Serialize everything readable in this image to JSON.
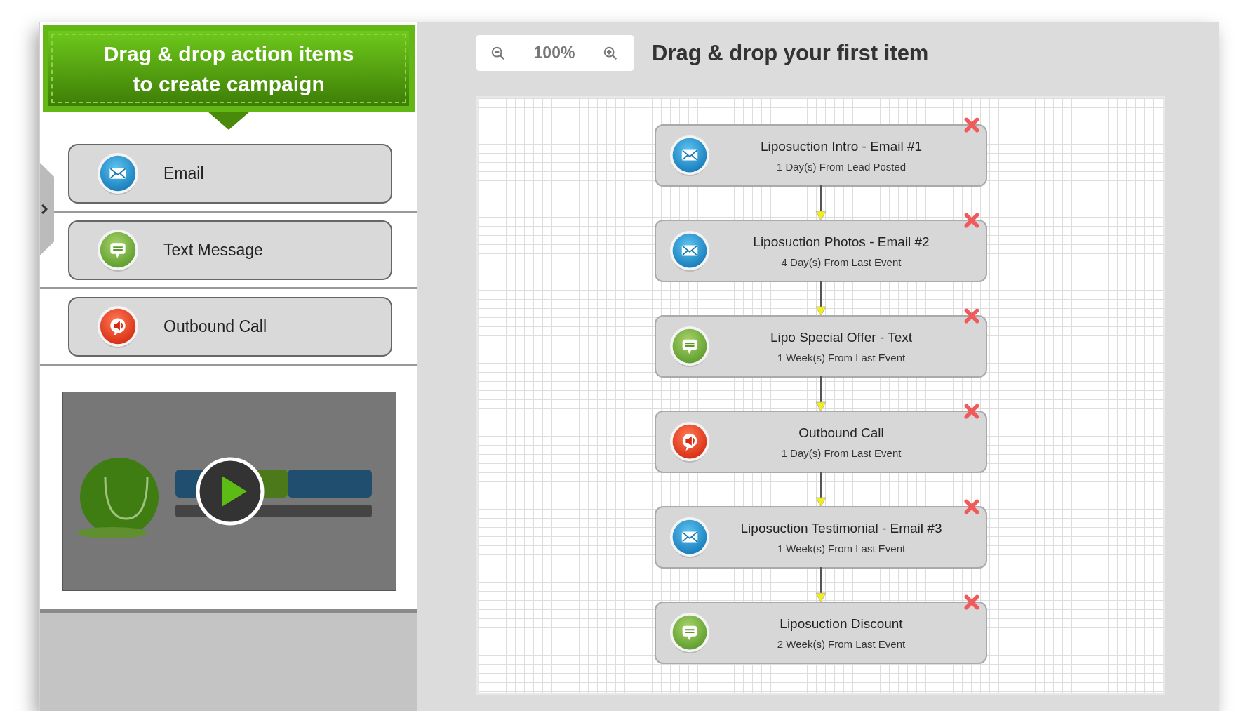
{
  "sidebar": {
    "banner": "Drag & drop action items\nto create campaign",
    "items": [
      {
        "kind": "email",
        "label": "Email"
      },
      {
        "kind": "text",
        "label": "Text Message"
      },
      {
        "kind": "call",
        "label": "Outbound Call"
      }
    ]
  },
  "toolbar": {
    "zoom": "100%",
    "title": "Drag & drop your first item"
  },
  "flow": [
    {
      "kind": "email",
      "title": "Liposuction Intro - Email #1",
      "timing": "1 Day(s) From Lead Posted"
    },
    {
      "kind": "email",
      "title": "Liposuction Photos - Email #2",
      "timing": "4 Day(s) From Last Event"
    },
    {
      "kind": "text",
      "title": "Lipo Special Offer - Text",
      "timing": "1 Week(s) From Last Event"
    },
    {
      "kind": "call",
      "title": "Outbound Call",
      "timing": "1 Day(s) From Last Event"
    },
    {
      "kind": "email",
      "title": "Liposuction Testimonial - Email #3",
      "timing": "1 Week(s) From Last Event"
    },
    {
      "kind": "text",
      "title": "Liposuction Discount",
      "timing": "2 Week(s) From Last Event"
    }
  ]
}
